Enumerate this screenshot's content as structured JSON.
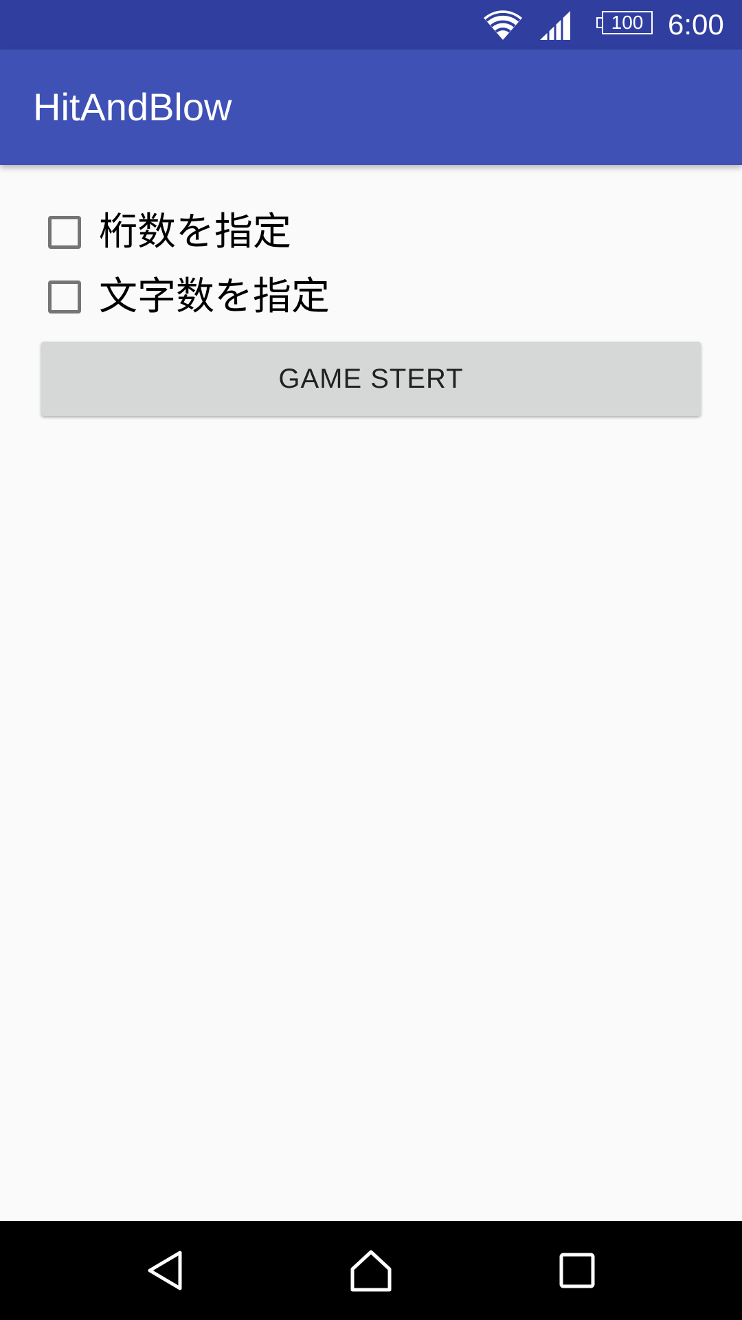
{
  "status_bar": {
    "battery_level": "100",
    "time": "6:00",
    "icons": [
      "wifi-icon",
      "signal-icon",
      "battery-icon"
    ]
  },
  "app_bar": {
    "title": "HitAndBlow"
  },
  "content": {
    "checkboxes": [
      {
        "label": "桁数を指定",
        "checked": false
      },
      {
        "label": "文字数を指定",
        "checked": false
      }
    ],
    "start_button_label": "GAME STERT"
  },
  "nav_bar": {
    "icons": [
      "back-icon",
      "home-icon",
      "recents-icon"
    ]
  },
  "colors": {
    "status_bar": "#303f9f",
    "app_bar": "#3f51b5",
    "background": "#fafafa",
    "button": "#d6d7d7",
    "nav_bar": "#000000"
  }
}
